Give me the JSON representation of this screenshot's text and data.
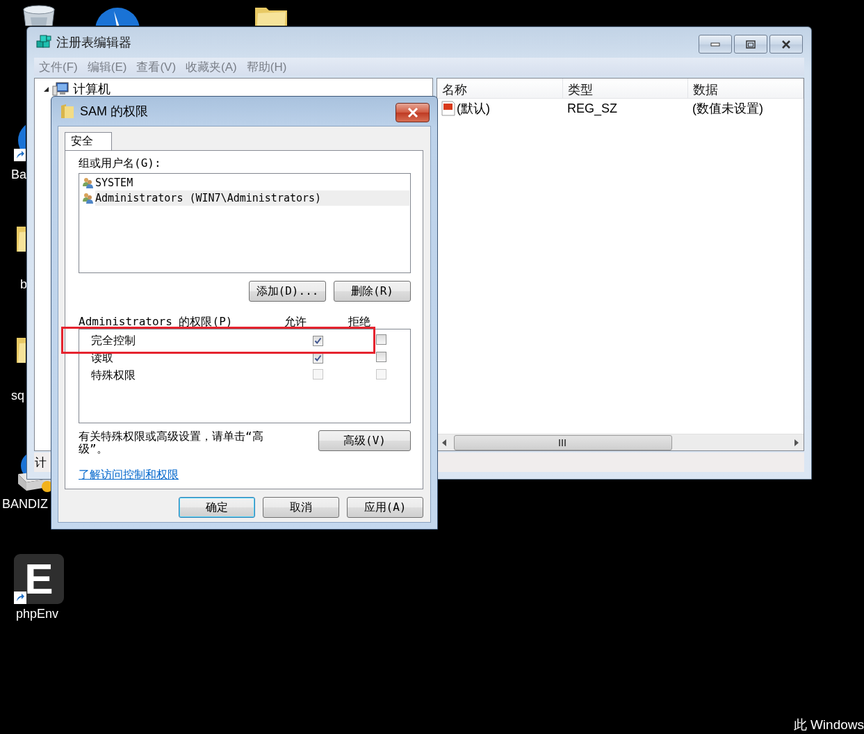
{
  "desktop": {
    "icons": [
      {
        "kind": "recycle-bin"
      },
      {
        "kind": "blue-circle"
      },
      {
        "kind": "folder"
      },
      {
        "kind": "blue-circle-shortcut",
        "label": "Ba"
      },
      {
        "kind": "folder",
        "label": "b"
      },
      {
        "kind": "folder",
        "label": "sq"
      },
      {
        "kind": "installer",
        "label": "BANDIZ"
      },
      {
        "kind": "app-tile",
        "glyph": "E",
        "label": "phpEnv"
      }
    ],
    "notice": "此 Windows"
  },
  "registry_window": {
    "title": "注册表编辑器",
    "menu": [
      "文件(F)",
      "编辑(E)",
      "查看(V)",
      "收藏夹(A)",
      "帮助(H)"
    ],
    "tree": [
      {
        "label": "计算机",
        "expanded": true
      }
    ],
    "table": {
      "columns": [
        "名称",
        "类型",
        "数据"
      ],
      "rows": [
        {
          "name": "(默认)",
          "type": "REG_SZ",
          "data": "(数值未设置)"
        }
      ]
    },
    "status_bar": "计"
  },
  "dialog": {
    "title": "SAM 的权限",
    "tabs": [
      {
        "label": "安全",
        "selected": true
      }
    ],
    "groups_label": "组或用户名(G):",
    "groups": [
      {
        "name": "SYSTEM",
        "selected": false
      },
      {
        "name": "Administrators (WIN7\\Administrators)",
        "selected": true
      }
    ],
    "group_buttons": [
      "添加(D)...",
      "删除(R)"
    ],
    "permissions": {
      "label": "Administrators 的权限(P)",
      "allow_header": "允许",
      "deny_header": "拒绝",
      "rows": [
        {
          "name": "完全控制",
          "allow": {
            "checked": true,
            "disabled": false
          },
          "deny": {
            "checked": false,
            "disabled": false
          }
        },
        {
          "name": "读取",
          "allow": {
            "checked": true,
            "disabled": false
          },
          "deny": {
            "checked": false,
            "disabled": false
          }
        },
        {
          "name": "特殊权限",
          "allow": {
            "checked": false,
            "disabled": true
          },
          "deny": {
            "checked": false,
            "disabled": true
          }
        }
      ]
    },
    "advanced_text": "有关特殊权限或高级设置，请单击“高级”。",
    "advanced_button": "高级(V)",
    "link": "了解访问控制和权限",
    "buttons": [
      {
        "label": "确定",
        "default": true
      },
      {
        "label": "取消",
        "default": false
      },
      {
        "label": "应用(A)",
        "default": false
      }
    ]
  },
  "annotations": [
    {
      "kind": "rectangle"
    }
  ]
}
